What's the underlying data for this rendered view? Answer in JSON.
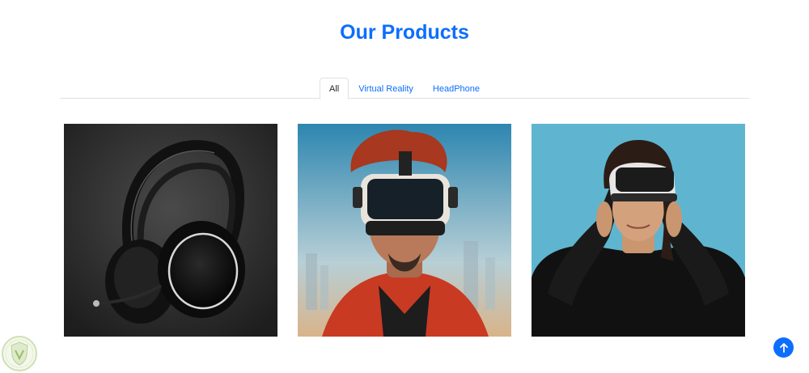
{
  "page": {
    "title": "Our Products"
  },
  "tabs": [
    {
      "label": "All",
      "active": true
    },
    {
      "label": "Virtual Reality",
      "active": false
    },
    {
      "label": "HeadPhone",
      "active": false
    }
  ],
  "products": [
    {
      "image": "headphones-product-image",
      "bg": "#2b2b2b"
    },
    {
      "image": "vr-headset-man-image",
      "bg": "#7fb3c8"
    },
    {
      "image": "vr-headset-woman-image",
      "bg": "#5fb5cf"
    }
  ],
  "colors": {
    "accent": "#0d6efd",
    "border": "#dee2e6"
  },
  "icons": {
    "back_to_top": "arrow-up-icon",
    "watermark": "shield-logo-icon"
  }
}
